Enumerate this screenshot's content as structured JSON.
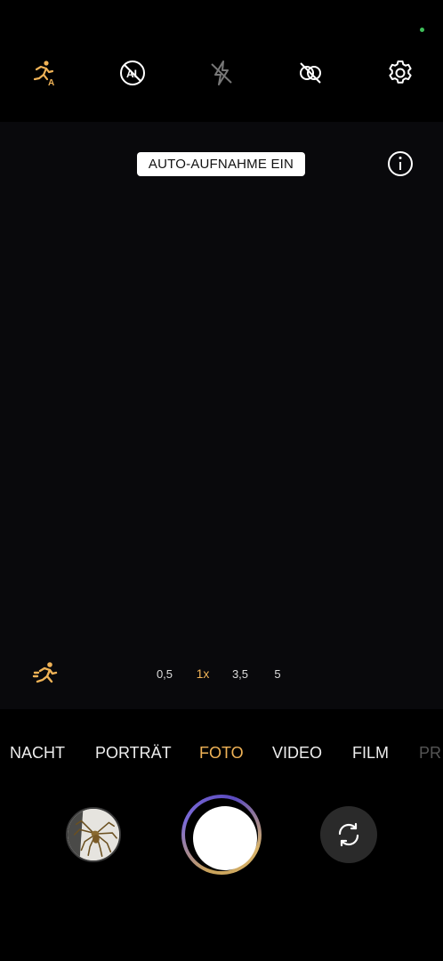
{
  "status": {
    "indicator_color": "#3fbf5a"
  },
  "topbar": {
    "icons": [
      "auto-motion-icon",
      "ai-off-icon",
      "flash-off-icon",
      "live-photo-off-icon",
      "settings-gear-icon"
    ]
  },
  "viewfinder": {
    "toast": "AUTO-AUFNAHME EIN",
    "info_icon": "info-icon",
    "motion_icon": "motion-runner-icon",
    "zoom_levels": [
      "0,5",
      "1x",
      "3,5",
      "5"
    ],
    "zoom_active": "1x"
  },
  "modes": {
    "items": [
      "NACHT",
      "PORTRÄT",
      "FOTO",
      "VIDEO",
      "FILM",
      "PR"
    ],
    "active": "FOTO"
  },
  "controls": {
    "gallery_thumbnail": "spider-photo-thumbnail",
    "shutter": "shutter-button",
    "switch_camera_icon": "camera-switch-icon"
  },
  "colors": {
    "accent": "#f0b357",
    "background": "#000000"
  }
}
